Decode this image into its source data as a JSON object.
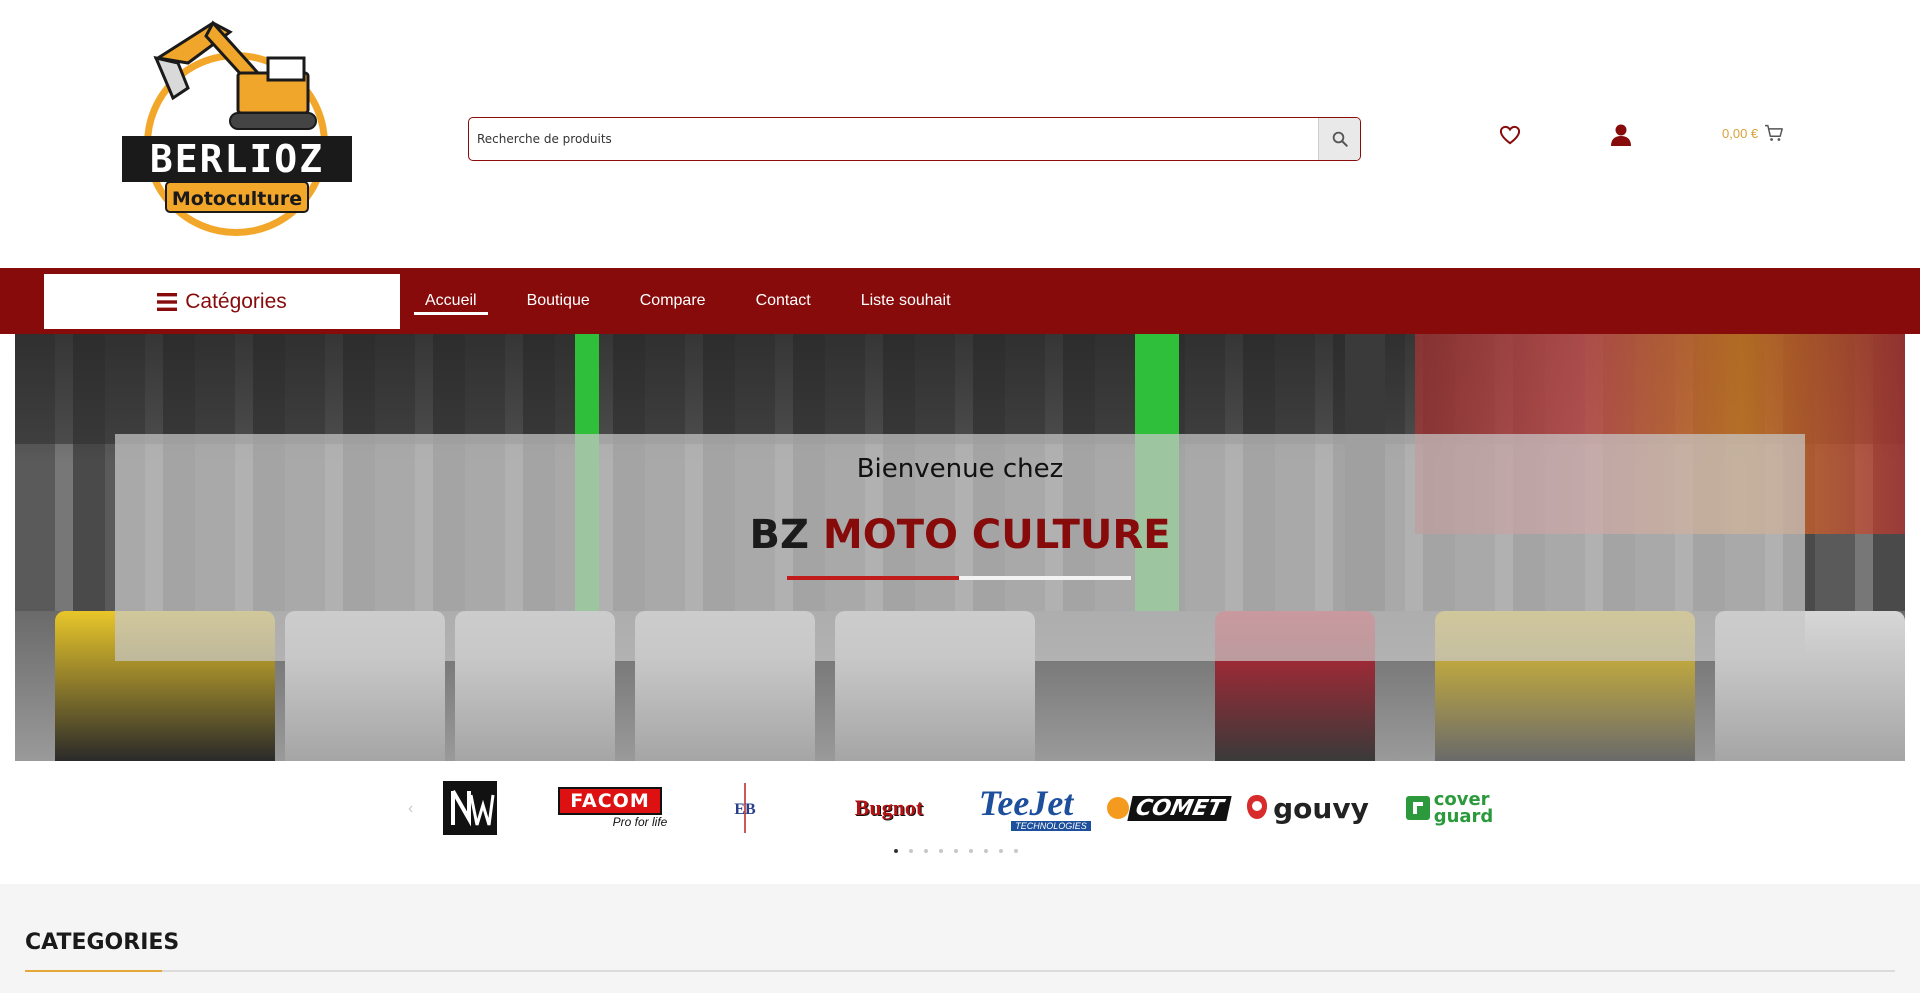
{
  "header": {
    "logo": {
      "line1": "BERLIOZ",
      "line2": "Motoculture"
    },
    "search": {
      "placeholder": "Recherche de produits"
    },
    "cart_total": "0,00 €"
  },
  "nav": {
    "categories_label": "Catégories",
    "items": [
      {
        "label": "Accueil",
        "active": true
      },
      {
        "label": "Boutique"
      },
      {
        "label": "Compare"
      },
      {
        "label": "Contact"
      },
      {
        "label": "Liste souhait"
      }
    ]
  },
  "hero": {
    "subtitle": "Bienvenue chez",
    "title_part1": "BZ",
    "title_part2": "MOTO CULTURE"
  },
  "brands": {
    "items": [
      "FACOM",
      "Pro for life",
      "Bugnot",
      "TeeJet",
      "TECHNOLOGIES",
      "COMET",
      "gouvy",
      "cover",
      "guard"
    ]
  },
  "sections": {
    "categories_title": "CATEGORIES"
  },
  "colors": {
    "brand_red": "#870b0b",
    "accent_gold": "#e2a83a",
    "cart_gold": "#d9a23b"
  }
}
